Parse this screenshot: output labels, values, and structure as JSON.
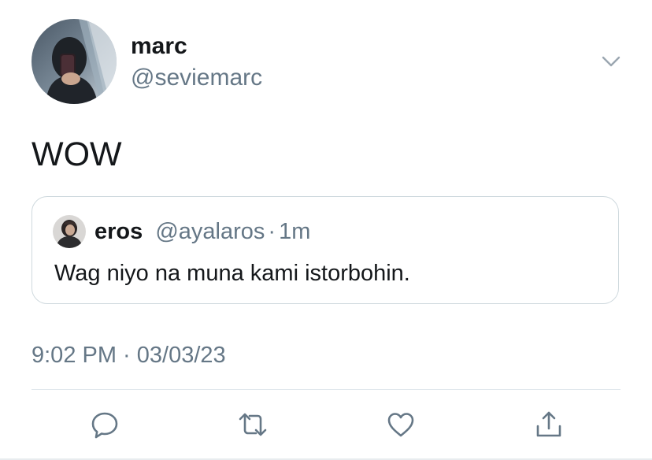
{
  "author": {
    "display_name": "marc",
    "handle": "@seviemarc",
    "avatar": "profile-photo"
  },
  "tweet": {
    "text": "WOW",
    "timestamp": "9:02 PM · 03/03/23"
  },
  "quoted_tweet": {
    "display_name": "eros",
    "handle": "@ayalaros",
    "separator": "·",
    "age": "1m",
    "text": "Wag niyo na muna kami istorbohin.",
    "avatar": "profile-photo"
  },
  "actions": [
    {
      "icon": "reply-icon"
    },
    {
      "icon": "retweet-icon"
    },
    {
      "icon": "like-icon"
    },
    {
      "icon": "share-icon"
    }
  ],
  "colors": {
    "text": "#14171a",
    "secondary": "#657786",
    "border": "#cfd9de",
    "icon": "#657786"
  }
}
